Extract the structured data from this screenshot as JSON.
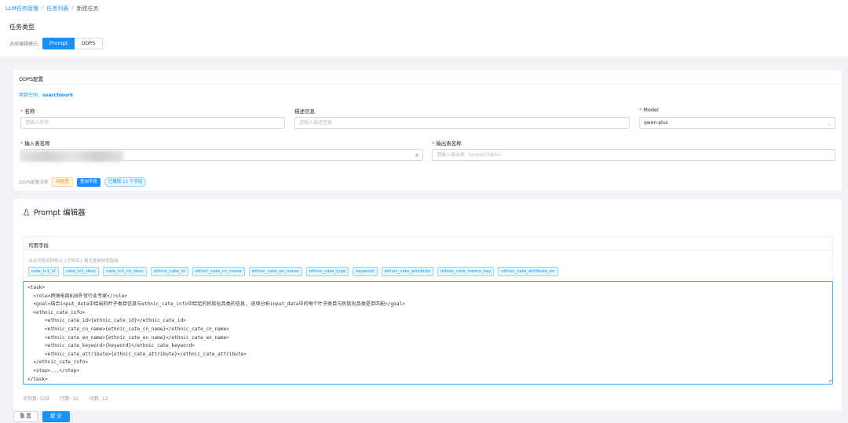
{
  "breadcrumb": {
    "root": "LLM任务管理",
    "list": "任务列表",
    "current": "新建任务",
    "sep": "/"
  },
  "page": {
    "title": "任务类型"
  },
  "mode": {
    "label": "选择编辑模式:",
    "options": [
      "Prompt",
      "ODPS"
    ],
    "selected": "Prompt"
  },
  "odps": {
    "title": "ODPS配置",
    "project_label": "项目空间:",
    "project_value": "searchwork",
    "fields": {
      "name": {
        "label": "名称",
        "placeholder": "请输入名称"
      },
      "desc": {
        "label": "描述信息",
        "placeholder": "请输入描述信息"
      },
      "model": {
        "label": "Model",
        "value": "qwen-plus"
      },
      "input_table": {
        "label": "输入表名称"
      },
      "output_table": {
        "label": "输出表名称",
        "placeholder": "请输入输出表（project.table）"
      }
    },
    "status_label": "ODPS配置读表",
    "status_tag": "待配置",
    "query_button": "查询字段",
    "fields_loaded": "已展取 11 个字段"
  },
  "prompt": {
    "title": "Prompt 编辑器",
    "fields_title": "可用字段",
    "fields_hint": "点击字段名称将以 {字段名} 格式复制到剪贴板",
    "field_chips": [
      "cate_lv1_id",
      "cate_lv1_desc",
      "cate_lv1_cn_desc",
      "ethnic_cate_id",
      "ethnic_cate_cn_name",
      "ethnic_cate_en_name",
      "ethnic_cate_type",
      "keyword",
      "ethnic_cate_attribute",
      "ethnic_cate_memo_key",
      "ethnic_cate_attribute_en"
    ],
    "code_lines": [
      "<task>",
      "  <role>跨境电商B2B外贸行业专家</role>",
      "  <goal>结合input_data中给出的叶子类目信息与ethnic_cate_info中给定的民族化品类的信息, 逐项分析input_data中的每个叶子类目与民族化品类是否匹配</goal>",
      "  <ethnic_cate_info>",
      "      <ethnic_cate_id>{ethnic_cate_id}</ethnic_cate_id>",
      "      <ethnic_cate_cn_name>{ethnic_cate_cn_name}</ethnic_cate_cn_name>",
      "      <ethnic_cate_en_name>{ethnic_cate_en_name}</ethnic_cate_en_name>",
      "      <ethnic_cate_keyword>{keyword}</ethnic_cate_keyword>",
      "      <ethnic_cate_attribute>{ethnic_cate_attribute}</ethnic_cate_attribute>",
      "  </ethnic_cate_info>",
      "  <step>...</step>",
      "</task>"
    ],
    "stats": {
      "chars": "字符数: 529",
      "lines": "行数: 12",
      "rows": "间数: 12"
    }
  },
  "actions": {
    "reset": "重 置",
    "submit": "提 交"
  },
  "colors": {
    "primary": "#1890ff",
    "warning": "#fa8c16",
    "danger": "#ff4d4f"
  }
}
